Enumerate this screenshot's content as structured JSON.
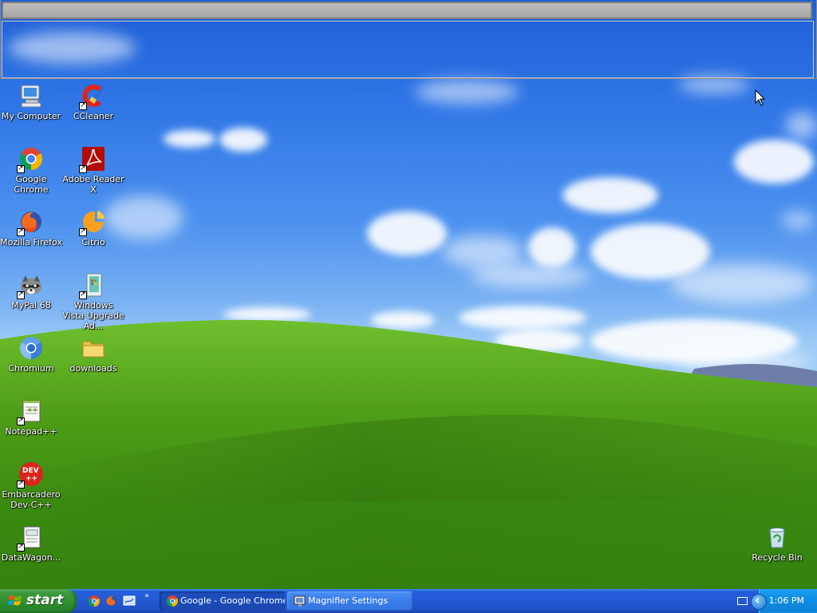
{
  "desktop": {
    "icons": [
      {
        "label": "My Computer",
        "icon": "my-computer-icon"
      },
      {
        "label": "CCleaner",
        "icon": "ccleaner-icon"
      },
      {
        "label": "Google Chrome",
        "icon": "chrome-icon"
      },
      {
        "label": "Adobe Reader X",
        "icon": "adobe-reader-icon"
      },
      {
        "label": "Mozilla Firefox",
        "icon": "firefox-icon"
      },
      {
        "label": "Citrio",
        "icon": "citrio-icon"
      },
      {
        "label": "MyPal 68",
        "icon": "mypal-icon"
      },
      {
        "label": "Windows Vista Upgrade Ad...",
        "icon": "vista-upgrade-icon"
      },
      {
        "label": "Chromium",
        "icon": "chromium-icon"
      },
      {
        "label": "downloads",
        "icon": "folder-icon"
      },
      {
        "label": "Notepad++",
        "icon": "notepadpp-icon"
      },
      {
        "label": "Embarcadero Dev-C++",
        "icon": "devcpp-icon"
      },
      {
        "label": "DataWagon...",
        "icon": "datawagon-icon"
      },
      {
        "label": "Recycle Bin",
        "icon": "recycle-bin-icon"
      }
    ]
  },
  "taskbar": {
    "start_label": "start",
    "quick_launch_more": "»",
    "tasks": [
      {
        "label": "Google - Google Chrome",
        "icon": "chrome-icon",
        "state": "active"
      },
      {
        "label": "Magnifier Settings",
        "icon": "magnifier-icon",
        "state": "normal"
      }
    ],
    "clock": "1:06 PM"
  },
  "colors": {
    "taskbar_blue": "#245edb",
    "start_green": "#2f8f2f",
    "tray_blue": "#118ee4"
  }
}
